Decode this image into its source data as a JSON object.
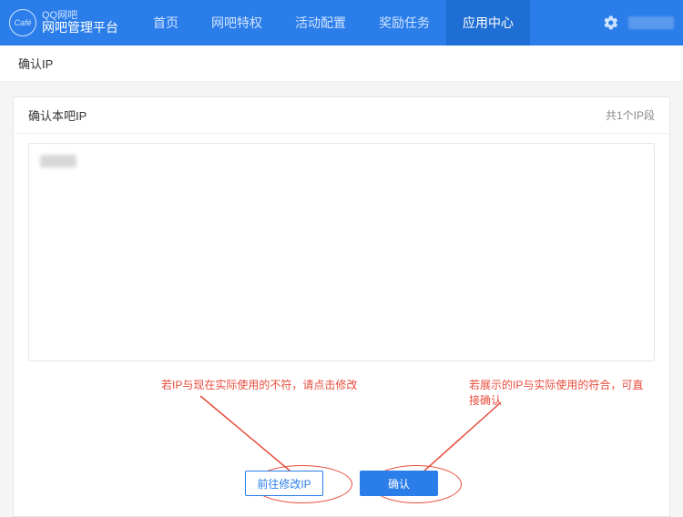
{
  "header": {
    "logo_small": "QQ网吧",
    "logo_big": "网吧管理平台",
    "logo_badge": "Café",
    "nav": [
      "首页",
      "网吧特权",
      "活动配置",
      "奖励任务",
      "应用中心"
    ],
    "active_nav_index": 4
  },
  "sub_bar": {
    "title": "确认IP"
  },
  "panel": {
    "title": "确认本吧IP",
    "count_text": "共1个IP段"
  },
  "buttons": {
    "modify": "前往修改IP",
    "confirm": "确认"
  },
  "annotations": {
    "left": "若IP与现在实际使用的不符，请点击修改",
    "right": "若展示的IP与实际使用的符合，可直接确认"
  }
}
